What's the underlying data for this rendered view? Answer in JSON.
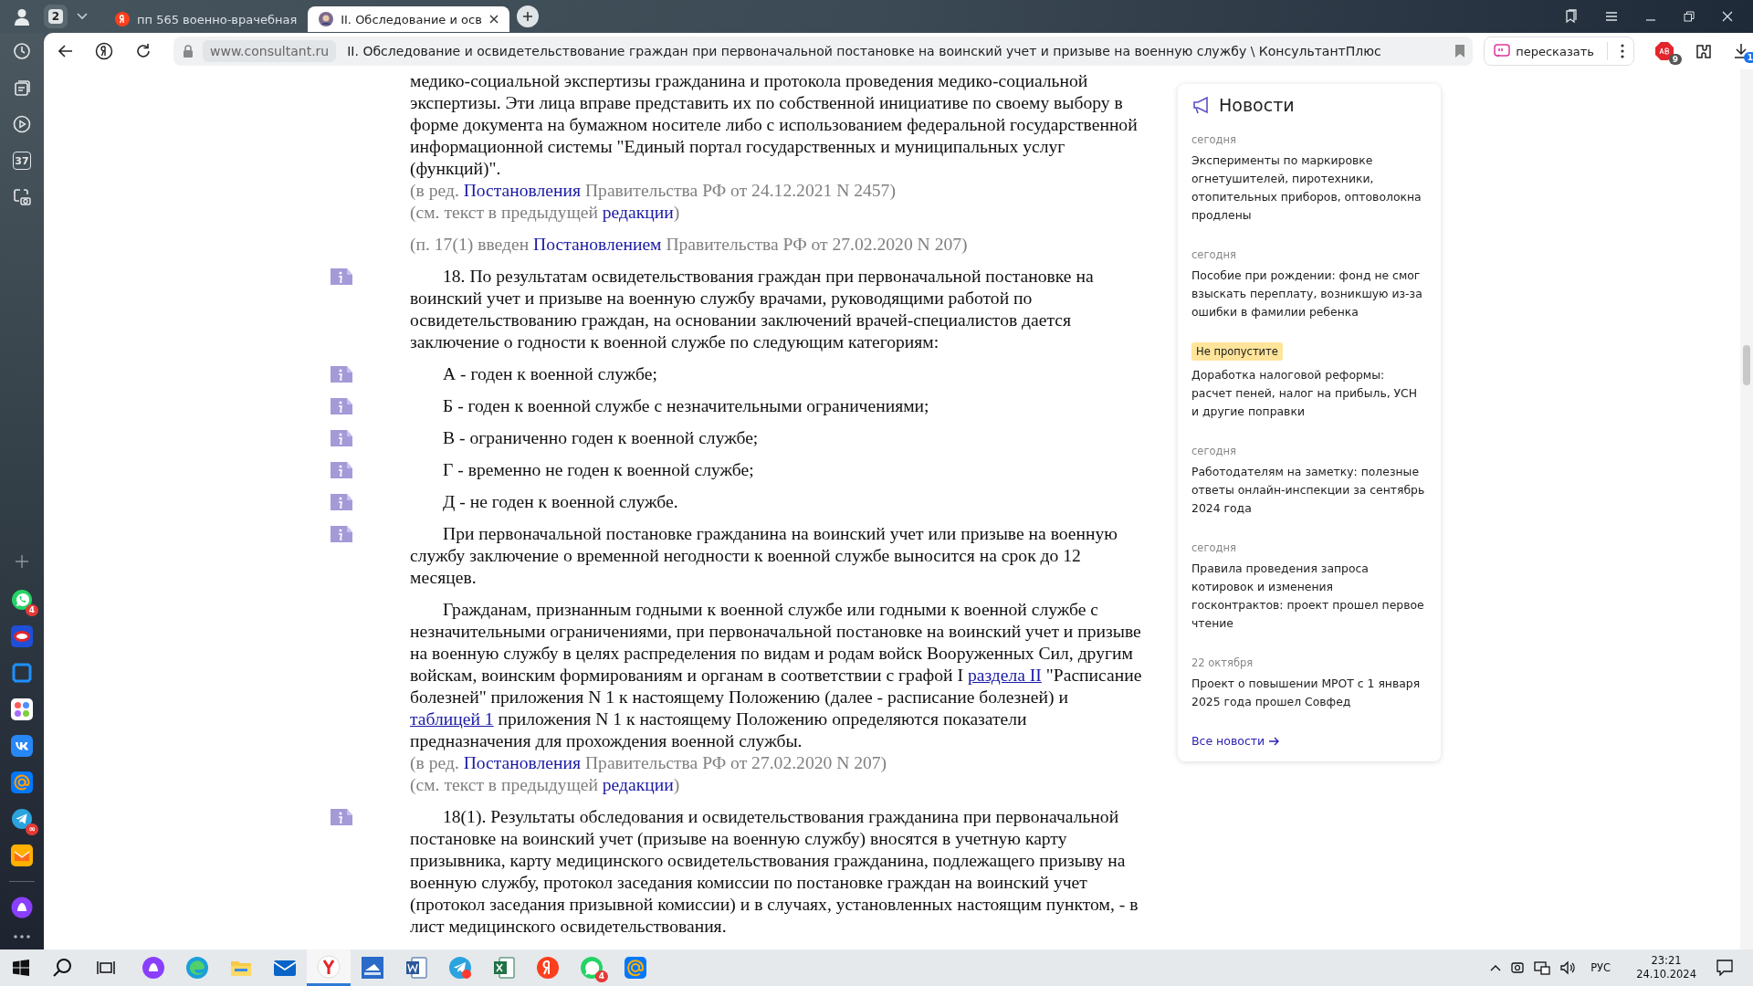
{
  "browser": {
    "tab_count": "2",
    "tabs": [
      {
        "title": "пп 565 военно-врачебная",
        "kind": "yandex",
        "selected": false
      },
      {
        "title": "II. Обследование и осв",
        "kind": "consultant",
        "selected": true
      }
    ],
    "address": {
      "domain": "www.consultant.ru",
      "page_title": "II. Обследование и освидетельствование граждан при первоначальной постановке на воинский учет и призыве на военную службу \\ КонсультантПлюс"
    },
    "retell_button": "пересказать",
    "adblock_badge": "9",
    "downloads_badge": "1"
  },
  "sidebar": {
    "calendar_day": "37",
    "apps": [
      {
        "kind": "whatsapp",
        "badge": "4"
      },
      {
        "kind": "ring"
      },
      {
        "kind": "frame"
      },
      {
        "kind": "dots"
      },
      {
        "kind": "vk"
      },
      {
        "kind": "at"
      },
      {
        "kind": "telegram",
        "badge": "∞"
      },
      {
        "kind": "envelope"
      },
      {
        "kind": "alice"
      }
    ]
  },
  "document": {
    "paragraphs": [
      {
        "kind": "continuation",
        "info": false,
        "text": [
          {
            "text": "медико-социальной экспертизы гражданина и протокола проведения медико-социальной экспертизы. Эти лица вправе представить их по собственной инициативе по своему выбору в форме документа на бумажном носителе либо с использованием федеральной государственной информационной системы \"Единый портал государственных и муниципальных услуг (функций)\"."
          }
        ],
        "notes": [
          [
            {
              "text": "(в ред. "
            },
            {
              "link": "Постановления"
            },
            {
              "text": " Правительства РФ от 24.12.2021 N 2457)"
            }
          ],
          [
            {
              "text": "(см. текст в предыдущей "
            },
            {
              "link": "редакции"
            },
            {
              "text": ")"
            }
          ]
        ]
      },
      {
        "kind": "note",
        "info": false,
        "text": [
          {
            "text": "(п. 17(1) введен "
          },
          {
            "link": "Постановлением"
          },
          {
            "text": " Правительства РФ от 27.02.2020 N 207)"
          }
        ]
      },
      {
        "kind": "body",
        "info": true,
        "text": [
          {
            "text": "18. По результатам освидетельствования граждан при первоначальной постановке на воинский учет и призыве на военную службу врачами, руководящими работой по освидетельствованию граждан, на основании заключений врачей-специалистов дается заключение о годности к военной службе по следующим категориям:"
          }
        ]
      },
      {
        "kind": "body",
        "info": true,
        "text": [
          {
            "text": "А - годен к военной службе;"
          }
        ]
      },
      {
        "kind": "body",
        "info": true,
        "text": [
          {
            "text": "Б - годен к военной службе с незначительными ограничениями;"
          }
        ]
      },
      {
        "kind": "body",
        "info": true,
        "text": [
          {
            "text": "В - ограниченно годен к военной службе;"
          }
        ]
      },
      {
        "kind": "body",
        "info": true,
        "text": [
          {
            "text": "Г - временно не годен к военной службе;"
          }
        ]
      },
      {
        "kind": "body",
        "info": true,
        "text": [
          {
            "text": "Д - не годен к военной службе."
          }
        ]
      },
      {
        "kind": "body",
        "info": true,
        "text": [
          {
            "text": "При первоначальной постановке гражданина на воинский учет или призыве на военную службу заключение о временной негодности к военной службе выносится на срок до 12 месяцев."
          }
        ]
      },
      {
        "kind": "body",
        "info": false,
        "text": [
          {
            "text": "Гражданам, признанным годными к военной службе или годными к военной службе с незначительными ограничениями, при первоначальной постановке на воинский учет и призыве на военную службу в целях распределения по видам и родам войск Вооруженных Сил, другим войскам, воинским формированиям и органам в соответствии с графой I "
          },
          {
            "link": "раздела II"
          },
          {
            "text": " \"Расписание болезней\" приложения N 1 к настоящему Положению (далее - расписание болезней) и "
          },
          {
            "link": "таблицей 1"
          },
          {
            "text": " приложения N 1 к настоящему Положению определяются показатели предназначения для прохождения военной службы."
          }
        ],
        "notes": [
          [
            {
              "text": "(в ред. "
            },
            {
              "link": "Постановления"
            },
            {
              "text": " Правительства РФ от 27.02.2020 N 207)"
            }
          ],
          [
            {
              "text": "(см. текст в предыдущей "
            },
            {
              "link": "редакции"
            },
            {
              "text": ")"
            }
          ]
        ]
      },
      {
        "kind": "body",
        "info": true,
        "text": [
          {
            "text": "18(1). Результаты обследования и освидетельствования гражданина при первоначальной постановке на воинский учет (призыве на военную службу) вносятся в учетную карту призывника, карту медицинского освидетельствования гражданина, подлежащего призыву на военную службу, протокол заседания комиссии по постановке граждан на воинский учет (протокол заседания призывной комиссии) и в случаях, установленных настоящим пунктом, - в лист медицинского освидетельствования."
          }
        ]
      }
    ]
  },
  "news": {
    "title": "Новости",
    "items": [
      {
        "kind": "date",
        "label": "сегодня",
        "headline": "Эксперименты по маркировке огнетушителей, пиротехники, отопительных приборов, оптоволокна продлены"
      },
      {
        "kind": "date",
        "label": "сегодня",
        "headline": "Пособие при рождении: фонд не смог взыскать переплату, возникшую из-за ошибки в фамилии ребенка"
      },
      {
        "kind": "highlight",
        "label": "Не пропустите",
        "headline": "Доработка налоговой реформы: расчет пеней, налог на прибыль, УСН и другие поправки"
      },
      {
        "kind": "date",
        "label": "сегодня",
        "headline": "Работодателям на заметку: полезные ответы онлайн-инспекции за сентябрь 2024 года"
      },
      {
        "kind": "date",
        "label": "сегодня",
        "headline": "Правила проведения запроса котировок и изменения госконтрактов: проект прошел первое чтение"
      },
      {
        "kind": "date",
        "label": "22 октября",
        "headline": "Проект о повышении МРОТ с 1 января 2025 года прошел Совфед"
      }
    ],
    "all_link": "Все новости"
  },
  "taskbar": {
    "apps": [
      {
        "kind": "alice",
        "active": false
      },
      {
        "kind": "edge",
        "active": false
      },
      {
        "kind": "folder",
        "active": false
      },
      {
        "kind": "mail",
        "active": false
      },
      {
        "kind": "yandex-browser",
        "active": true
      },
      {
        "kind": "scanner",
        "active": false
      },
      {
        "kind": "word",
        "active": false
      },
      {
        "kind": "telegram",
        "active": false
      },
      {
        "kind": "excel",
        "active": false
      },
      {
        "kind": "yandex",
        "active": false
      },
      {
        "kind": "whatsapp",
        "active": false,
        "badge": "4"
      },
      {
        "kind": "at",
        "active": false
      }
    ],
    "language": "РУС",
    "time": "23:21",
    "date": "24.10.2024"
  }
}
